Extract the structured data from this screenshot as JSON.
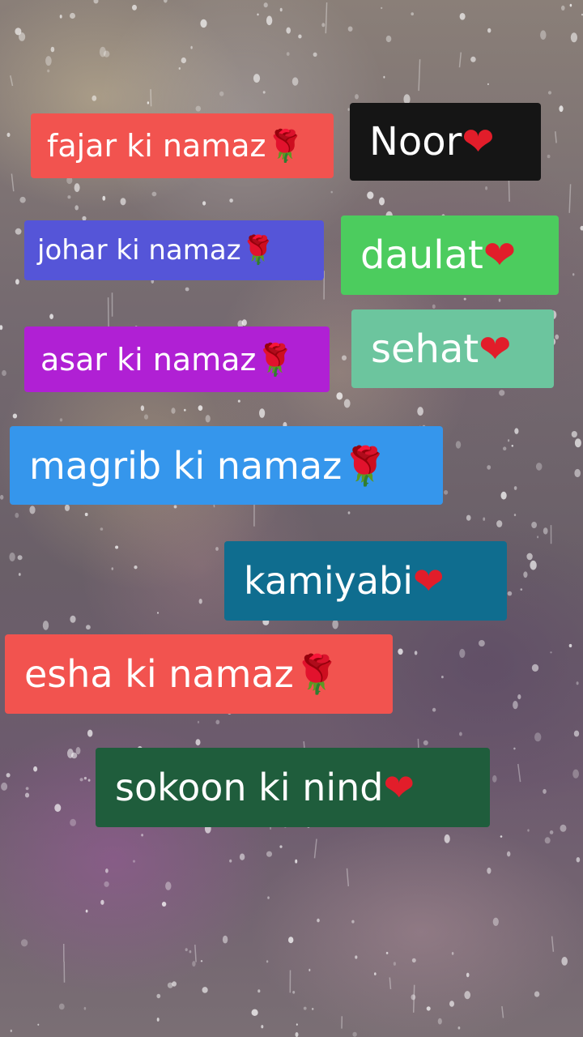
{
  "labels": [
    {
      "text": "fajar ki namaz",
      "emoji": "🌹",
      "bg": "#f2534f"
    },
    {
      "text": "Noor",
      "emoji": "❤",
      "bg": "#151515"
    },
    {
      "text": "johar ki namaz ",
      "emoji": "🌹",
      "bg": "#5555d8"
    },
    {
      "text": "daulat",
      "emoji": "❤",
      "bg": "#4ccc5e"
    },
    {
      "text": "asar ki namaz",
      "emoji": "🌹",
      "bg": "#b020d4"
    },
    {
      "text": "sehat",
      "emoji": "❤",
      "bg": "#6cc59e"
    },
    {
      "text": "magrib ki namaz ",
      "emoji": "🌹",
      "bg": "#3596ec"
    },
    {
      "text": "kamiyabi ",
      "emoji": "❤",
      "bg": "#0f6d8f"
    },
    {
      "text": "esha ki namaz ",
      "emoji": "🌹",
      "bg": "#f2534f"
    },
    {
      "text": "sokoon ki nind ",
      "emoji": "❤",
      "bg": "#1f5d3c"
    }
  ]
}
